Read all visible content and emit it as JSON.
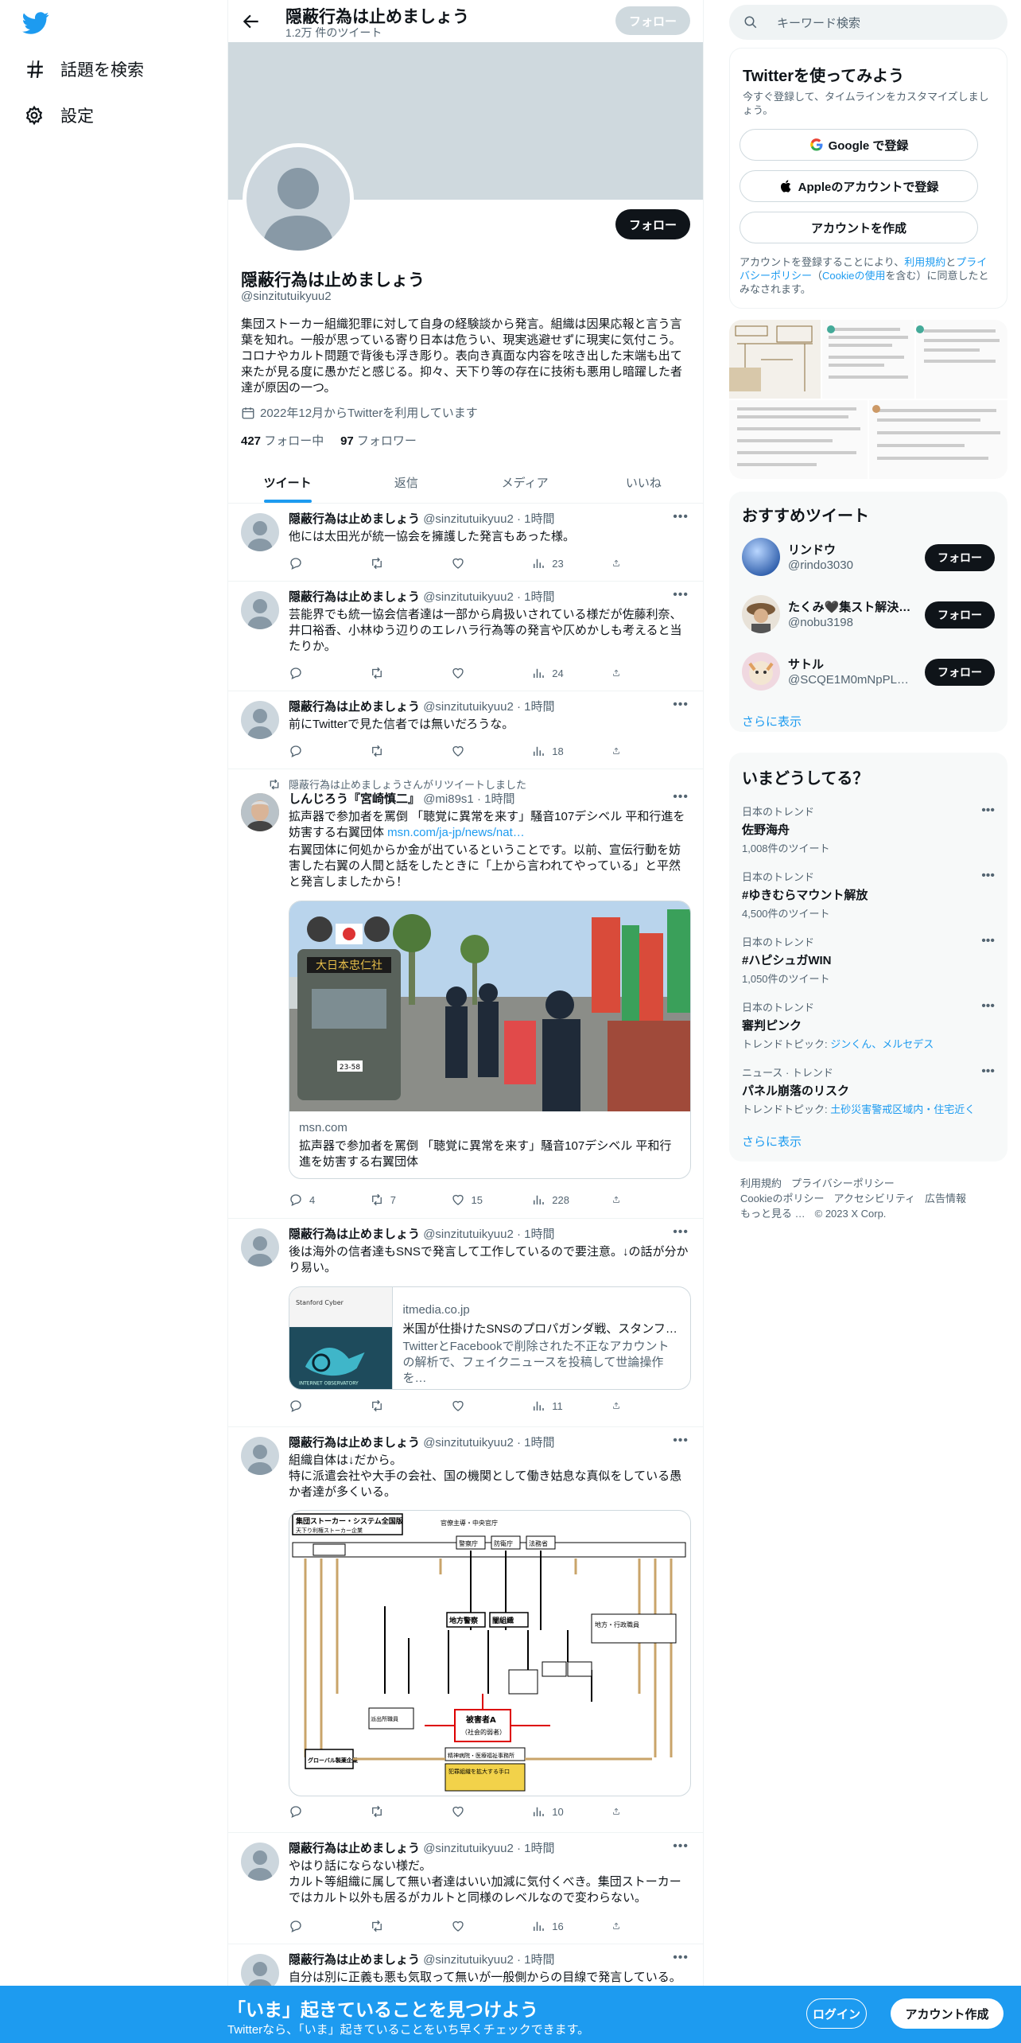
{
  "left_nav": {
    "items": [
      {
        "label": "話題を検索"
      },
      {
        "label": "設定"
      }
    ]
  },
  "header": {
    "title": "隠蔽行為は止めましょう",
    "subtitle": "1.2万 件のツイート",
    "follow_label": "フォロー"
  },
  "profile": {
    "name": "隠蔽行為は止めましょう",
    "handle": "@sinzitutuikyuu2",
    "follow_label": "フォロー",
    "bio": "集団ストーカー組織犯罪に対して自身の経験談から発言。組織は因果応報と言う言葉を知れ。一般が思っている寄り日本は危うい、現実逃避せずに現実に気付こう。コロナやカルト問題で背後も浮き彫り。表向き真面な内容を呟き出した末端も出て来たが見る度に愚かだと感じる。抑々、天下り等の存在に技術も悪用し暗躍した者達が原因の一つ。",
    "joined": "2022年12月からTwitterを利用しています",
    "following_count": "427",
    "following_label": "フォロー中",
    "followers_count": "97",
    "followers_label": "フォロワー"
  },
  "tabs": [
    {
      "label": "ツイート"
    },
    {
      "label": "返信"
    },
    {
      "label": "メディア"
    },
    {
      "label": "いいね"
    }
  ],
  "tweets": [
    {
      "name": "隠蔽行為は止めましょう",
      "handle": "@sinzitutuikyuu2",
      "time": "1時間",
      "text": "他には太田光が統一協会を擁護した発言もあった様。",
      "views": "23"
    },
    {
      "name": "隠蔽行為は止めましょう",
      "handle": "@sinzitutuikyuu2",
      "time": "1時間",
      "text": "芸能界でも統一協会信者達は一部から肩扱いされている様だが佐藤利奈、井口裕香、小林ゆう辺りのエレハラ行為等の発言や仄めかしも考えると当たりか。",
      "views": "24"
    },
    {
      "name": "隠蔽行為は止めましょう",
      "handle": "@sinzitutuikyuu2",
      "time": "1時間",
      "text": "前にTwitterで見た信者では無いだろうな。",
      "views": "18"
    },
    {
      "retweet_note": "隠蔽行為は止めましょうさんがリツイートしました",
      "name": "しんじろう『宮崎慎二』",
      "handle": "@mi89s1",
      "time": "1時間",
      "text1": "拡声器で参加者を罵倒 「聴覚に異常を来す」騒音107デシベル 平和行進を妨害する右翼団体 ",
      "link": "msn.com/ja-jp/news/nat…",
      "text2": "右翼団体に何処からか金が出ているということです。以前、宣伝行動を妨害した右翼の人間と話をしたときに「上から言われてやっている」と平然と発言しましたから！",
      "truck_sign": "大日本忠仁社",
      "plate": "23-58",
      "card_domain": "msn.com",
      "card_title": "拡声器で参加者を罵倒 「聴覚に異常を来す」騒音107デシベル 平和行進を妨害する右翼団体",
      "replies": "4",
      "retweets": "7",
      "likes": "15",
      "views": "228"
    },
    {
      "name": "隠蔽行為は止めましょう",
      "handle": "@sinzitutuikyuu2",
      "time": "1時間",
      "text": "後は海外の信者達もSNSで発言して工作しているので要注意。↓の話が分かり易い。",
      "card_domain": "itmedia.co.jp",
      "card_title": "米国が仕掛けたSNSのプロパガンダ戦、スタンフ…",
      "card_desc": "TwitterとFacebookで削除された不正なアカウントの解析で、フェイクニュースを投稿して世論操作を…",
      "thumb_label": "Stanford Cyber",
      "thumb_caption": "INTERNET OBSERVATORY",
      "views": "11"
    },
    {
      "name": "隠蔽行為は止めましょう",
      "handle": "@sinzitutuikyuu2",
      "time": "1時間",
      "text": "組織自体は↓だから。\n特に派遣会社や大手の会社、国の機関として働き姑息な真似をしている愚か者達が多くいる。",
      "diagram": {
        "title": "集団ストーカー・システム全国版",
        "subtitle": "天下り利権ストーカー企業",
        "top_label": "官僚主導・中央官庁",
        "agencies": [
          "警察庁",
          "防衛庁",
          "法務省"
        ],
        "mid": [
          "地方警察",
          "闇組織"
        ],
        "victim": "被害者A",
        "victim_sub": "（社会的弱者）",
        "left_box": "派出所職員",
        "corp": "グローバル製薬企業",
        "right_box": "地方・行政職員",
        "bottom": "精神病院・医療福祉事務所",
        "note": "犯罪組織を拡大する手口"
      },
      "views": "10"
    },
    {
      "name": "隠蔽行為は止めましょう",
      "handle": "@sinzitutuikyuu2",
      "time": "1時間",
      "text": "やはり話にならない様だ。\nカルト等組織に属して無い者達はいい加減に気付くべき。集団ストーカーではカルト以外も居るがカルトと同様のレベルなので変わらない。",
      "views": "16"
    },
    {
      "name": "隠蔽行為は止めましょう",
      "handle": "@sinzitutuikyuu2",
      "time": "1時間",
      "text": "自分は別に正義も悪も気取って無いが一般側からの目線で発言している。"
    }
  ],
  "search": {
    "placeholder": "キーワード検索"
  },
  "signup": {
    "title": "Twitterを使ってみよう",
    "subtitle": "今すぐ登録して、タイムラインをカスタマイズしましょう。",
    "google": "Google で登録",
    "apple": "Appleのアカウントで登録",
    "create": "アカウントを作成",
    "legal1": "アカウントを登録することにより、",
    "legal_link1": "利用規約",
    "legal2": "と",
    "legal_link2": "プライバシーポリシー",
    "legal3": "（",
    "legal_link3": "Cookieの使用",
    "legal4": "を含む）に同意したとみなされます。"
  },
  "recommended": {
    "title": "おすすめツイート",
    "users": [
      {
        "name": "リンドウ",
        "handle": "@rindo3030",
        "button": "フォロー"
      },
      {
        "name": "たくみ🖤集スト解決…",
        "handle": "@nobu3198",
        "button": "フォロー"
      },
      {
        "name": "サトル",
        "handle": "@SCQE1M0mNpPL…",
        "button": "フォロー"
      }
    ],
    "more": "さらに表示"
  },
  "trends": {
    "title": "いまどうしてる？",
    "items": [
      {
        "context": "日本のトレンド",
        "title": "佐野海舟",
        "count": "1,008件のツイート"
      },
      {
        "context": "日本のトレンド",
        "title": "#ゆきむらマウント解放",
        "count": "4,500件のツイート"
      },
      {
        "context": "日本のトレンド",
        "title": "#ハピシュガWIN",
        "count": "1,050件のツイート"
      },
      {
        "context": "日本のトレンド",
        "title": "審判ピンク",
        "count_prefix": "トレンドトピック: ",
        "count_links": "ジンくん、メルセデス"
      },
      {
        "context": "ニュース · トレンド",
        "title": "パネル崩落のリスク",
        "count_prefix": "トレンドトピック: ",
        "count_links": "土砂災害警戒区域内・住宅近く"
      }
    ],
    "more": "さらに表示"
  },
  "footer": {
    "links": [
      "利用規約",
      "プライバシーポリシー",
      "Cookieのポリシー",
      "アクセシビリティ",
      "広告情報",
      "もっと見る …",
      "© 2023 X Corp."
    ]
  },
  "bottom_bar": {
    "title": "「いま」起きていることを見つけよう",
    "subtitle": "Twitterなら、「いま」起きていることをいち早くチェックできます。",
    "login": "ログイン",
    "signup": "アカウント作成"
  },
  "colors": {
    "accent": "#1d9bf0",
    "text": "#0f1419",
    "muted": "#536471"
  }
}
